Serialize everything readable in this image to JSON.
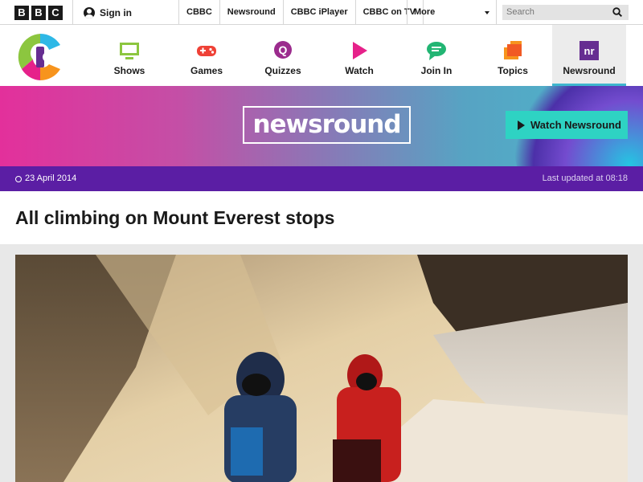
{
  "bbc_bar": {
    "logo_letters": [
      "B",
      "B",
      "C"
    ],
    "signin_label": "Sign in",
    "links": [
      "CBBC",
      "Newsround",
      "CBBC iPlayer",
      "CBBC on TV"
    ],
    "more_label": "More",
    "search_placeholder": "Search"
  },
  "cbbc_nav": {
    "items": [
      {
        "label": "Shows",
        "icon": "tv-icon",
        "color": "#8cc63f"
      },
      {
        "label": "Games",
        "icon": "gamepad-icon",
        "color": "#ef4136"
      },
      {
        "label": "Quizzes",
        "icon": "quiz-icon",
        "color": "#9b2b8d"
      },
      {
        "label": "Watch",
        "icon": "play-icon",
        "color": "#e6218a"
      },
      {
        "label": "Join In",
        "icon": "chat-icon",
        "color": "#22b573"
      },
      {
        "label": "Topics",
        "icon": "topics-icon",
        "color": "#f7941d"
      },
      {
        "label": "Newsround",
        "icon": "newsround-icon",
        "color": "#662d91",
        "active": true
      }
    ]
  },
  "banner": {
    "logo_text": "newsround",
    "watch_button": "Watch Newsround"
  },
  "article": {
    "date": "23 April 2014",
    "updated": "Last updated at 08:18",
    "headline": "All climbing on Mount Everest stops"
  },
  "colors": {
    "datebar": "#5b1ea4",
    "watch_button": "#2ed3c3",
    "active_underline": "#3fb6ce"
  }
}
